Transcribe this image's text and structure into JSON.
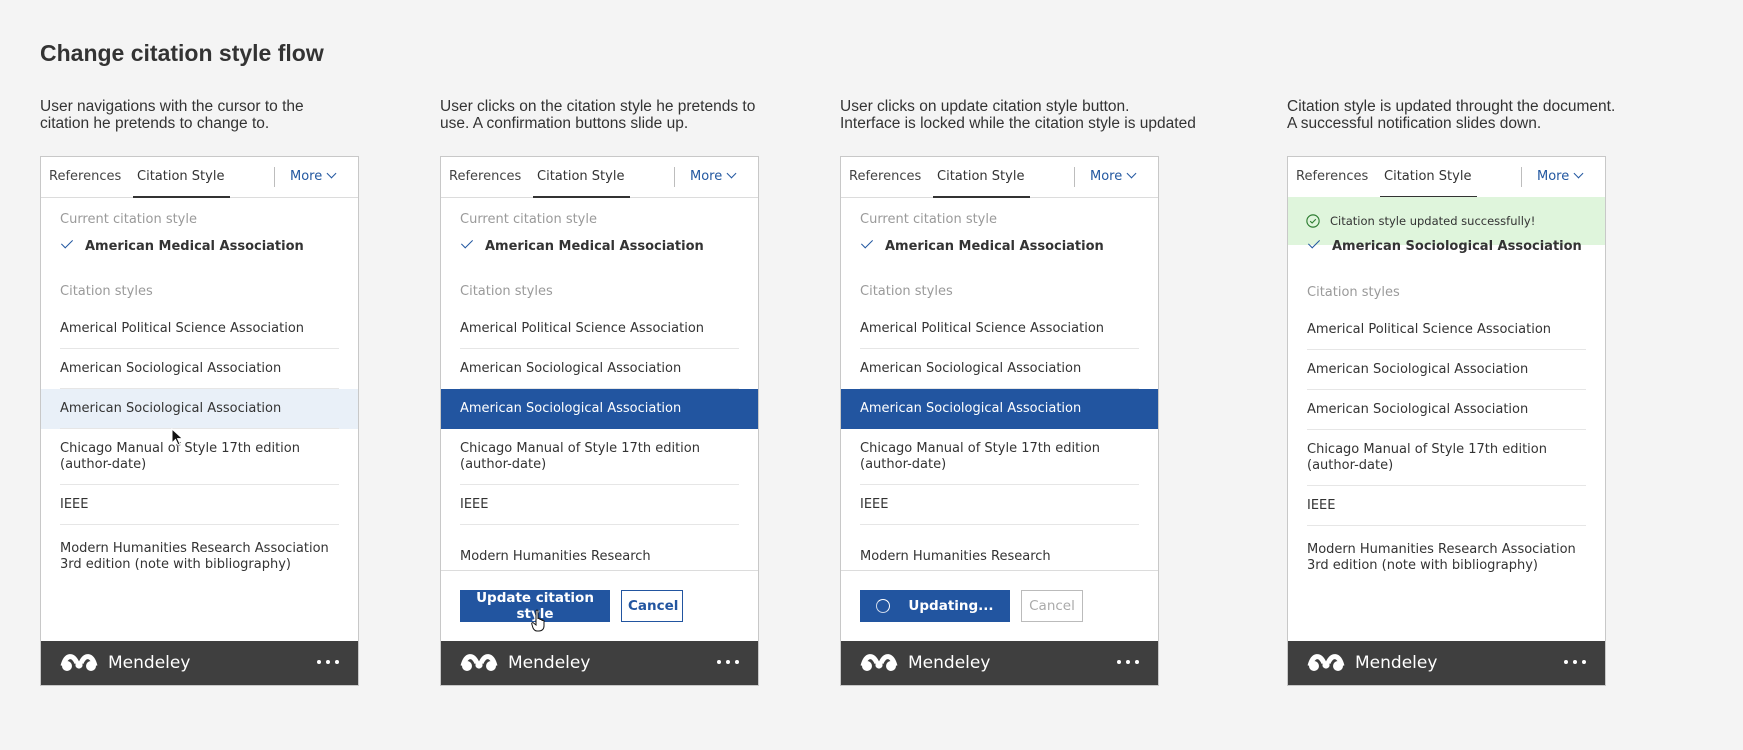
{
  "page_title": "Change citation style flow",
  "tabs": {
    "references": "References",
    "citation_style": "Citation Style",
    "more": "More"
  },
  "current_label": "Current citation style",
  "styles_label": "Citation styles",
  "footer": {
    "brand": "Mendeley"
  },
  "steps": [
    {
      "description": "User navigations with the cursor to the\ncitation he pretends to change to.",
      "current_style": "American Medical Association",
      "styles": [
        "Americal Political Science Association",
        "American Sociological Association",
        "American Sociological Association",
        "Chicago Manual of Style 17th edition (author-date)",
        "IEEE",
        "Modern Humanities Research Association 3rd edition (note with bibliography)"
      ],
      "hover_index": 2
    },
    {
      "description": "User clicks on the citation style he pretends to\nuse. A confirmation buttons slide up.",
      "current_style": "American Medical Association",
      "styles": [
        "Americal Political Science Association",
        "American Sociological Association",
        "American Sociological Association",
        "Chicago Manual of Style 17th edition (author-date)",
        "IEEE",
        "Modern Humanities Research"
      ],
      "selected_index": 2,
      "update_button": "Update citation style",
      "cancel_button": "Cancel"
    },
    {
      "description": "User clicks on update citation style button.\nInterface is locked while the citation style is updated",
      "current_style": "American Medical Association",
      "styles": [
        "Americal Political Science Association",
        "American Sociological Association",
        "American Sociological Association",
        "Chicago Manual of Style 17th edition (author-date)",
        "IEEE",
        "Modern Humanities Research"
      ],
      "selected_index": 2,
      "update_button": "Updating...",
      "cancel_button": "Cancel"
    },
    {
      "description": "Citation style is updated throught the document.\nA successful notification slides down.",
      "notification": "Citation style updated successfully!",
      "current_style": "American Sociological Association",
      "styles": [
        "Americal Political Science Association",
        "American Sociological Association",
        "American Sociological Association",
        "Chicago Manual of Style 17th edition (author-date)",
        "IEEE",
        "Modern Humanities Research Association 3rd edition (note with bibliography)"
      ]
    }
  ]
}
